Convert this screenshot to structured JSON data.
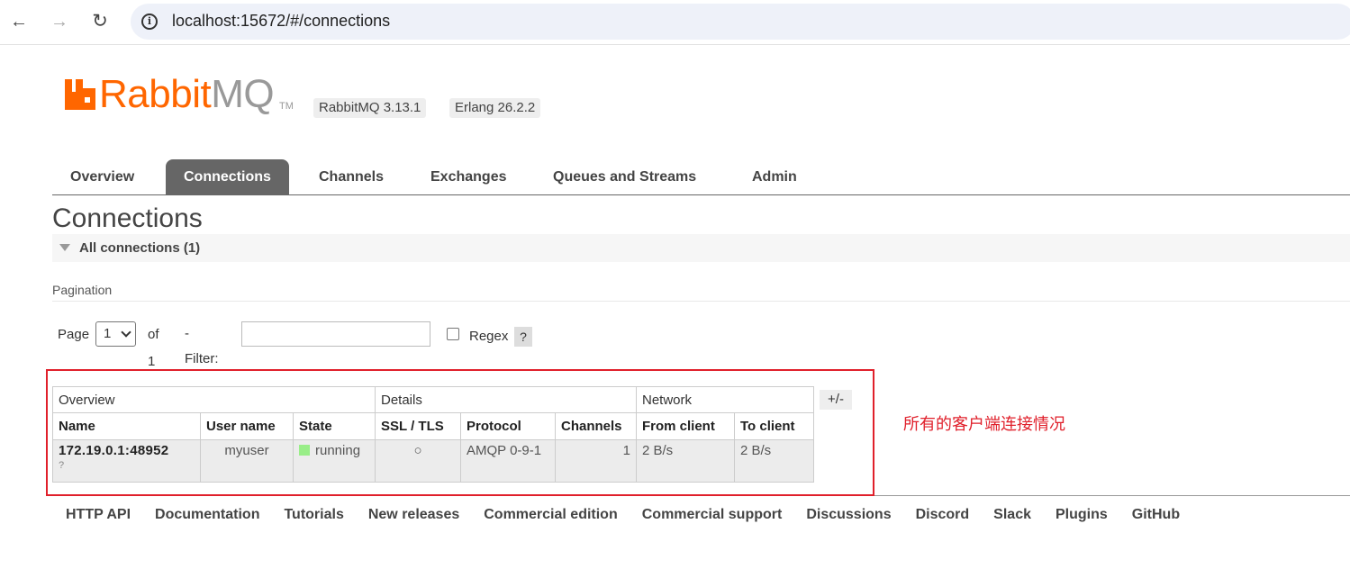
{
  "browser": {
    "url": "localhost:15672/#/connections"
  },
  "header": {
    "logo_rabbit": "Rabbit",
    "logo_mq": "MQ",
    "logo_tm": "TM",
    "rabbitmq_version": "RabbitMQ 3.13.1",
    "erlang_version": "Erlang 26.2.2"
  },
  "tabs": [
    {
      "label": "Overview",
      "active": false
    },
    {
      "label": "Connections",
      "active": true
    },
    {
      "label": "Channels",
      "active": false
    },
    {
      "label": "Exchanges",
      "active": false
    },
    {
      "label": "Queues and Streams",
      "active": false
    },
    {
      "label": "Admin",
      "active": false
    }
  ],
  "main": {
    "title": "Connections",
    "section": "All connections (1)",
    "pagination_label": "Pagination",
    "page_label": "Page",
    "page_value": "1",
    "of_label": "of 1",
    "filter_label": "- Filter:",
    "filter_value": "",
    "regex_label": "Regex",
    "help_label": "?",
    "plus_minus": "+/-"
  },
  "table": {
    "groups": [
      "Overview",
      "Details",
      "Network"
    ],
    "columns": [
      "Name",
      "User name",
      "State",
      "SSL / TLS",
      "Protocol",
      "Channels",
      "From client",
      "To client"
    ],
    "rows": [
      {
        "name": "172.19.0.1:48952",
        "name_sub": "?",
        "user": "myuser",
        "state": "running",
        "ssl": "○",
        "protocol": "AMQP 0-9-1",
        "channels": "1",
        "from_client": "2 B/s",
        "to_client": "2 B/s"
      }
    ]
  },
  "annotation": "所有的客户端连接情况",
  "footer": [
    "HTTP API",
    "Documentation",
    "Tutorials",
    "New releases",
    "Commercial edition",
    "Commercial support",
    "Discussions",
    "Discord",
    "Slack",
    "Plugins",
    "GitHub"
  ]
}
